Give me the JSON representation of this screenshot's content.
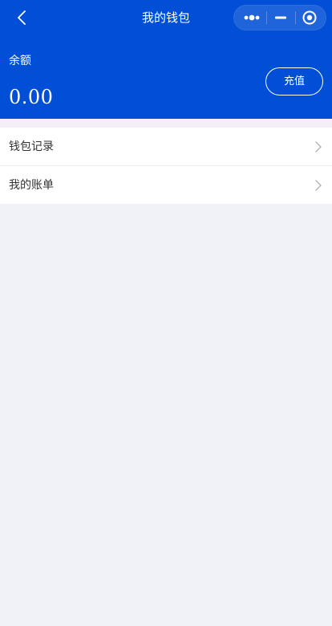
{
  "header": {
    "title": "我的钱包",
    "back_icon": "chevron-left-icon",
    "capsule_icons": [
      "more-dots-icon",
      "minimize-icon",
      "close-target-icon"
    ]
  },
  "balance": {
    "label": "余额",
    "amount": "0.00",
    "recharge_label": "充值"
  },
  "menu": {
    "items": [
      {
        "label": "钱包记录",
        "icon": "chevron-right-icon"
      },
      {
        "label": "我的账单",
        "icon": "chevron-right-icon"
      }
    ]
  },
  "colors": {
    "brand_blue": "#004fd6",
    "background": "#f0f2f7",
    "card": "#ffffff",
    "text": "#333333",
    "chevron": "#b4b4b4"
  }
}
